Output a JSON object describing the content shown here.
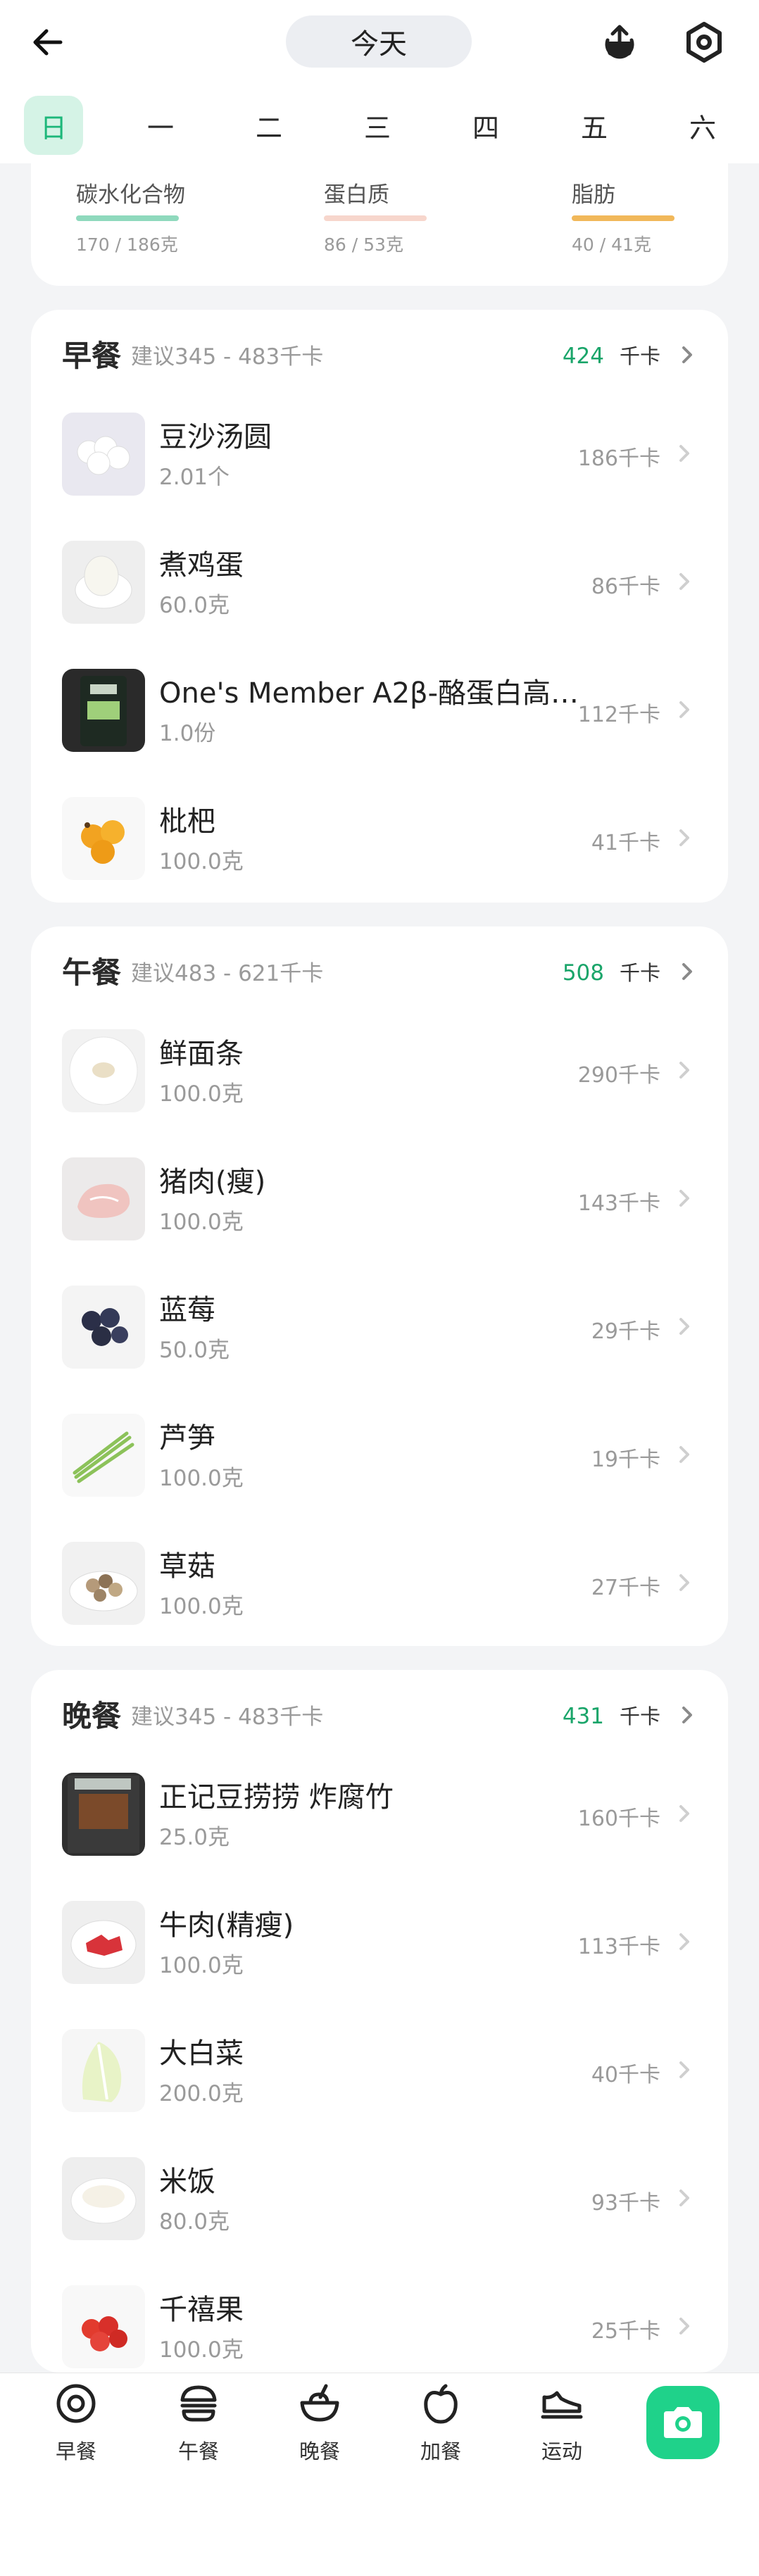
{
  "header": {
    "date_label": "今天"
  },
  "weekdays": [
    "日",
    "一",
    "二",
    "三",
    "四",
    "五",
    "六"
  ],
  "active_weekday": 0,
  "macros": [
    {
      "label": "碳水化合物",
      "value": "170 / 186克",
      "color": "#8fd9bd"
    },
    {
      "label": "蛋白质",
      "value": "86 / 53克",
      "color": "#f7d6cc"
    },
    {
      "label": "脂肪",
      "value": "40 / 41克",
      "color": "#f1b85a"
    }
  ],
  "meals": [
    {
      "title": "早餐",
      "suggest": "建议345 - 483千卡",
      "kcal": "424",
      "unit": "千卡",
      "items": [
        {
          "name": "豆沙汤圆",
          "amount": "2.01个",
          "kcal": "186千卡",
          "thumb": "tangyuan"
        },
        {
          "name": "煮鸡蛋",
          "amount": "60.0克",
          "kcal": "86千卡",
          "thumb": "egg"
        },
        {
          "name": "One's  Member A2β-酪蛋白高…",
          "amount": "1.0份",
          "kcal": "112千卡",
          "thumb": "milk"
        },
        {
          "name": "枇杷",
          "amount": "100.0克",
          "kcal": "41千卡",
          "thumb": "loquat"
        }
      ]
    },
    {
      "title": "午餐",
      "suggest": "建议483 - 621千卡",
      "kcal": "508",
      "unit": "千卡",
      "items": [
        {
          "name": "鲜面条",
          "amount": "100.0克",
          "kcal": "290千卡",
          "thumb": "noodle"
        },
        {
          "name": "猪肉(瘦)",
          "amount": "100.0克",
          "kcal": "143千卡",
          "thumb": "pork"
        },
        {
          "name": "蓝莓",
          "amount": "50.0克",
          "kcal": "29千卡",
          "thumb": "blueberry"
        },
        {
          "name": "芦笋",
          "amount": "100.0克",
          "kcal": "19千卡",
          "thumb": "asparagus"
        },
        {
          "name": "草菇",
          "amount": "100.0克",
          "kcal": "27千卡",
          "thumb": "mushroom"
        }
      ]
    },
    {
      "title": "晚餐",
      "suggest": "建议345 - 483千卡",
      "kcal": "431",
      "unit": "千卡",
      "items": [
        {
          "name": "正记豆捞捞 炸腐竹",
          "amount": "25.0克",
          "kcal": "160千卡",
          "thumb": "tofuskin"
        },
        {
          "name": "牛肉(精瘦)",
          "amount": "100.0克",
          "kcal": "113千卡",
          "thumb": "beef"
        },
        {
          "name": "大白菜",
          "amount": "200.0克",
          "kcal": "40千卡",
          "thumb": "cabbage"
        },
        {
          "name": "米饭",
          "amount": "80.0克",
          "kcal": "93千卡",
          "thumb": "rice"
        },
        {
          "name": "千禧果",
          "amount": "100.0克",
          "kcal": "25千卡",
          "thumb": "tomato"
        }
      ]
    }
  ],
  "bottom_nav": [
    {
      "label": "早餐",
      "icon": "plate-icon"
    },
    {
      "label": "午餐",
      "icon": "burger-icon"
    },
    {
      "label": "晚餐",
      "icon": "bowl-icon"
    },
    {
      "label": "加餐",
      "icon": "apple-icon"
    },
    {
      "label": "运动",
      "icon": "shoe-icon"
    }
  ],
  "colors": {
    "accent": "#1fd28a",
    "kcal_green": "#1aa56a",
    "active_day_bg": "#d5f3e6"
  }
}
